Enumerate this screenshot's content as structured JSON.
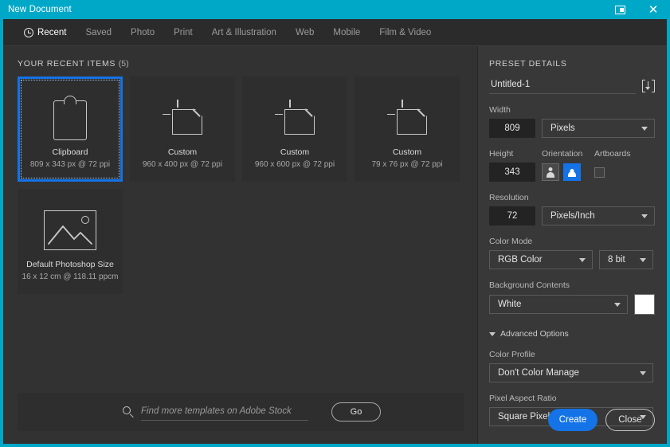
{
  "window": {
    "title": "New Document",
    "dock_icon": "dock-panel-icon",
    "close_icon": "close-icon",
    "accent_color": "#00a8c8"
  },
  "tabs": [
    {
      "label": "Recent",
      "icon": "clock-icon",
      "active": true
    },
    {
      "label": "Saved",
      "active": false
    },
    {
      "label": "Photo",
      "active": false
    },
    {
      "label": "Print",
      "active": false
    },
    {
      "label": "Art & Illustration",
      "active": false
    },
    {
      "label": "Web",
      "active": false
    },
    {
      "label": "Mobile",
      "active": false
    },
    {
      "label": "Film & Video",
      "active": false
    }
  ],
  "recent": {
    "heading": "YOUR RECENT ITEMS",
    "count": "(5)",
    "items": [
      {
        "title": "Clipboard",
        "subtitle": "809 x 343 px @ 72 ppi",
        "icon": "clipboard-icon",
        "selected": true
      },
      {
        "title": "Custom",
        "subtitle": "960 x 400 px @ 72 ppi",
        "icon": "custom-document-icon",
        "selected": false
      },
      {
        "title": "Custom",
        "subtitle": "960 x 600 px @ 72 ppi",
        "icon": "custom-document-icon",
        "selected": false
      },
      {
        "title": "Custom",
        "subtitle": "79 x 76 px @ 72 ppi",
        "icon": "custom-document-icon",
        "selected": false
      },
      {
        "title": "Default Photoshop Size",
        "subtitle": "16 x 12 cm @ 118.11 ppcm",
        "icon": "photo-icon",
        "selected": false
      }
    ]
  },
  "stock": {
    "placeholder": "Find more templates on Adobe Stock",
    "value": "",
    "search_icon": "search-icon",
    "go_label": "Go"
  },
  "preset": {
    "heading": "PRESET DETAILS",
    "name_value": "Untitled-1",
    "save_preset_icon": "save-preset-icon",
    "width": {
      "label": "Width",
      "value": "809",
      "unit": "Pixels"
    },
    "height": {
      "label": "Height",
      "value": "343"
    },
    "orientation": {
      "label": "Orientation",
      "portrait_icon": "portrait-orientation-icon",
      "landscape_icon": "landscape-orientation-icon",
      "selected": "landscape"
    },
    "artboards": {
      "label": "Artboards",
      "checked": false
    },
    "resolution": {
      "label": "Resolution",
      "value": "72",
      "unit": "Pixels/Inch"
    },
    "color_mode": {
      "label": "Color Mode",
      "value": "RGB Color",
      "depth": "8 bit"
    },
    "background": {
      "label": "Background Contents",
      "value": "White",
      "swatch_color": "#ffffff"
    },
    "advanced": {
      "label": "Advanced Options",
      "expanded": true
    },
    "color_profile": {
      "label": "Color Profile",
      "value": "Don't Color Manage"
    },
    "pixel_aspect": {
      "label": "Pixel Aspect Ratio",
      "value": "Square Pixels"
    }
  },
  "footer": {
    "create_label": "Create",
    "close_label": "Close"
  }
}
